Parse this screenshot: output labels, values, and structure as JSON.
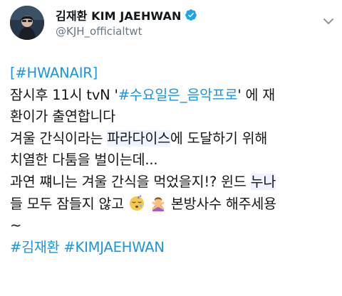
{
  "tweet": {
    "author": {
      "display_name": "김재환 KIM JAEHWAN",
      "handle": "@KJH_officialtwt",
      "verified": true,
      "avatar_icon": "avatar-photo",
      "verified_icon": "verified-badge-icon",
      "more_icon": "chevron-down-icon"
    },
    "content": {
      "line1_hashtag": "[#HWANAIR]",
      "line2_prefix": "잠시후 11시 tvN '",
      "line2_hashtag": "#수요일은_음악프로",
      "line2_suffix": "' 에 재",
      "line3": "환이가 출연합니다",
      "line4_prefix": "겨울 간식이라는 ",
      "line4_highlight": "파라다이스",
      "line4_suffix": "에 도달하기 위해",
      "line5": "치열한 다툼을 벌이는데...",
      "line6_prefix": "과연 쨰니는 겨울 간식을 먹었을지!? 윈드 ",
      "line6_highlight": "누나",
      "line7_prefix": "들 모두 잠들지 않고 ",
      "line7_emoji1": "sleeping-face-emoji",
      "line7_emoji2": "person-gesturing-no-emoji",
      "line7_suffix": " 본방사수 해주세용",
      "line8": "~",
      "line9_hashtag1": "#김재환",
      "line9_hashtag2": "#KIMJAEHWAN"
    },
    "colors": {
      "link": "#1b95e0",
      "text": "#14171a",
      "secondary": "#657786",
      "highlight": "#eef3fe",
      "verified": "#1da1f2"
    }
  }
}
